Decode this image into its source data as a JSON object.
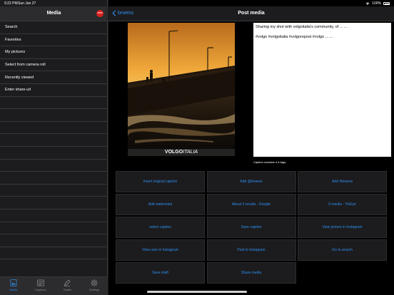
{
  "status_bar": {
    "time": "9:22 PM",
    "date": "Sun Jan 27",
    "battery": "100%"
  },
  "sidebar": {
    "title": "Media",
    "stop_label": "STOP",
    "items": [
      {
        "label": "Search"
      },
      {
        "label": "Favorites"
      },
      {
        "label": "My pictures"
      },
      {
        "label": "Select from camera roll"
      },
      {
        "label": "Recently viewed"
      },
      {
        "label": "Enter share-url"
      }
    ],
    "tabs": [
      {
        "label": "Media",
        "icon": "media-icon",
        "active": true
      },
      {
        "label": "Captions",
        "icon": "captions-icon",
        "active": false
      },
      {
        "label": "Drafts",
        "icon": "drafts-icon",
        "active": false
      },
      {
        "label": "Settings",
        "icon": "settings-icon",
        "active": false
      }
    ]
  },
  "main": {
    "back_label": "brwess",
    "title": "Post media",
    "photo_logo_bold": "VOLGO",
    "photo_logo_italic": "ITALIA",
    "caption_line1": "Sharing my shot with volgoitalia's community, of ... ...",
    "caption_line2": "#volgo #volgoitalia #volgorepost #volgo ... ...",
    "caption_note": "Caption contains 4 #-tags",
    "buttons": [
      "Insert original caption",
      "Add @brwess",
      "Add #brwess",
      "Add watermark",
      "About 3 results - Google",
      "0 results - TinEye",
      "select caption",
      "Save caption",
      "View picture in Instagram",
      "View user in Instagram",
      "Post to Instagram",
      "Go to search",
      "Save draft",
      "Share media"
    ]
  },
  "colors": {
    "accent": "#2f8ef0",
    "background": "#000000",
    "panel": "#1c1c1e",
    "stop": "#d9201f"
  }
}
